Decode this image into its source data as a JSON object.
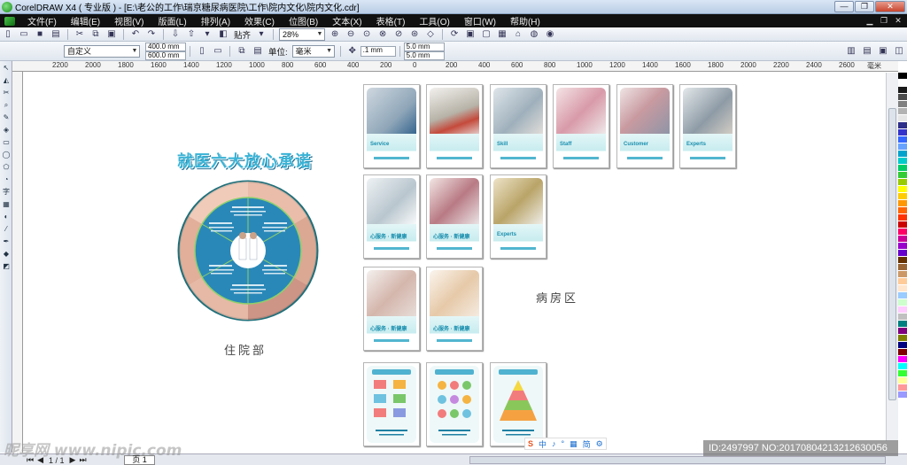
{
  "window": {
    "title": "CorelDRAW X4 ( 专业版 ) - [E:\\老公的工作\\瑞京糖尿病医院\\工作\\院内文化\\院内文化.cdr]",
    "buttons": [
      "—",
      "❐",
      "✕"
    ]
  },
  "menubar": {
    "items": [
      "文件(F)",
      "编辑(E)",
      "视图(V)",
      "版面(L)",
      "排列(A)",
      "效果(C)",
      "位图(B)",
      "文本(X)",
      "表格(T)",
      "工具(O)",
      "窗口(W)",
      "帮助(H)"
    ]
  },
  "toolbar1": {
    "align_label": "贴齐",
    "zoom": "28%"
  },
  "toolbar2": {
    "preset": "自定义",
    "width": "400.0 mm",
    "height": "600.0 mm",
    "unit_label": "单位:",
    "unit": "毫米",
    "nudge": ".1 mm",
    "dup_x": "5.0 mm",
    "dup_y": "5.0 mm"
  },
  "ruler": {
    "ticks": [
      "2200",
      "2000",
      "1800",
      "1600",
      "1400",
      "1200",
      "1000",
      "800",
      "600",
      "400",
      "200",
      "0",
      "200",
      "400",
      "600",
      "800",
      "1000",
      "1200",
      "1400",
      "1600",
      "1800",
      "2000",
      "2200",
      "2400",
      "2600",
      "2800",
      "3000",
      "毫米"
    ]
  },
  "canvas": {
    "main_title": "就医六大放心承诺",
    "label_inpatient": "住院部",
    "label_ward": "病房区",
    "thumb_tags": [
      "Service",
      "Skill",
      "Staff",
      "Customer",
      "Experts",
      "心服务 · 新健康",
      "Experts"
    ]
  },
  "status": {
    "page_count": "1 / 1",
    "page_tab": "页 1"
  },
  "overlay": {
    "site_watermark": "昵享网 www.nipic.com",
    "image_id": "ID:2497997 NO:20170804213212630056",
    "ime_items": [
      "S",
      "中",
      "♪",
      "°",
      "▦",
      "简",
      "⚙"
    ]
  },
  "palette": [
    "#000000",
    "#ffffff",
    "#1a1a1a",
    "#4d4d4d",
    "#808080",
    "#b3b3b3",
    "#e6e6e6",
    "#2d2d8a",
    "#3333cc",
    "#3366ff",
    "#66a3ff",
    "#00a3cc",
    "#00cccc",
    "#00cc66",
    "#33cc33",
    "#99cc00",
    "#ffff00",
    "#ffcc00",
    "#ff9900",
    "#ff6600",
    "#ff3300",
    "#cc0000",
    "#ff0066",
    "#cc0099",
    "#9900cc",
    "#6600cc",
    "#663300",
    "#996633",
    "#cc9966",
    "#ffcc99",
    "#ffe6cc",
    "#99ccff",
    "#ccffcc",
    "#ffccff",
    "#c0c0c0",
    "#008080",
    "#800080",
    "#808000",
    "#000080",
    "#800000",
    "#ff00ff",
    "#00ffff",
    "#33ff33",
    "#ffff99",
    "#ff9999",
    "#9999ff",
    "#ffffff"
  ]
}
